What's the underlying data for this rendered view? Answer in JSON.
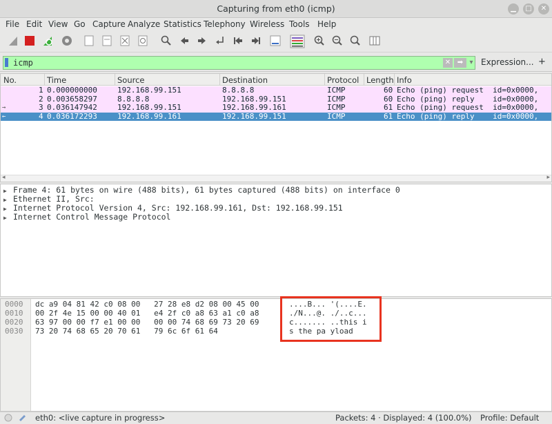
{
  "window": {
    "title": "Capturing from eth0 (icmp)"
  },
  "menu": [
    "File",
    "Edit",
    "View",
    "Go",
    "Capture",
    "Analyze",
    "Statistics",
    "Telephony",
    "Wireless",
    "Tools",
    "Help"
  ],
  "filter": {
    "value": "icmp",
    "expression_label": "Expression...",
    "plus_label": "+"
  },
  "packet_list": {
    "columns": [
      "No.",
      "Time",
      "Source",
      "Destination",
      "Protocol",
      "Length",
      "Info"
    ],
    "rows": [
      {
        "no": "1",
        "time": "0.000000000",
        "src": "192.168.99.151",
        "dst": "8.8.8.8",
        "proto": "ICMP",
        "len": "60",
        "info": "Echo (ping) request  id=0x0000,",
        "mark": ""
      },
      {
        "no": "2",
        "time": "0.003658297",
        "src": "8.8.8.8",
        "dst": "192.168.99.151",
        "proto": "ICMP",
        "len": "60",
        "info": "Echo (ping) reply    id=0x0000,",
        "mark": ""
      },
      {
        "no": "3",
        "time": "0.036147942",
        "src": "192.168.99.151",
        "dst": "192.168.99.161",
        "proto": "ICMP",
        "len": "61",
        "info": "Echo (ping) request  id=0x0000,",
        "mark": "→"
      },
      {
        "no": "4",
        "time": "0.036172293",
        "src": "192.168.99.161",
        "dst": "192.168.99.151",
        "proto": "ICMP",
        "len": "61",
        "info": "Echo (ping) reply    id=0x0000,",
        "mark": "←"
      }
    ]
  },
  "details": [
    "Frame 4: 61 bytes on wire (488 bits), 61 bytes captured (488 bits) on interface 0",
    "Ethernet II, Src:",
    "Internet Protocol Version 4, Src: 192.168.99.161, Dst: 192.168.99.151",
    "Internet Control Message Protocol"
  ],
  "bytes": [
    {
      "off": "0000",
      "hex": "dc a9 04 81 42 c0 08 00   27 28 e8 d2 08 00 45 00",
      "ascii": "....B... '(....E."
    },
    {
      "off": "0010",
      "hex": "00 2f 4e 15 00 00 40 01   e4 2f c0 a8 63 a1 c0 a8",
      "ascii": "./N...@. ./..c..."
    },
    {
      "off": "0020",
      "hex": "63 97 00 00 f7 e1 00 00   00 00 74 68 69 73 20 69",
      "ascii": "c....... ..this i"
    },
    {
      "off": "0030",
      "hex": "73 20 74 68 65 20 70 61   79 6c 6f 61 64",
      "ascii": "s the pa yload"
    }
  ],
  "status": {
    "interface": "eth0: <live capture in progress>",
    "packets": "Packets: 4 · Displayed: 4 (100.0%)",
    "profile": "Profile: Default"
  },
  "colors": {
    "selected": "#4a90c7",
    "icmp_row": "#fce0ff",
    "filter_ok": "#afffaf",
    "highlight": "#e8331f"
  }
}
